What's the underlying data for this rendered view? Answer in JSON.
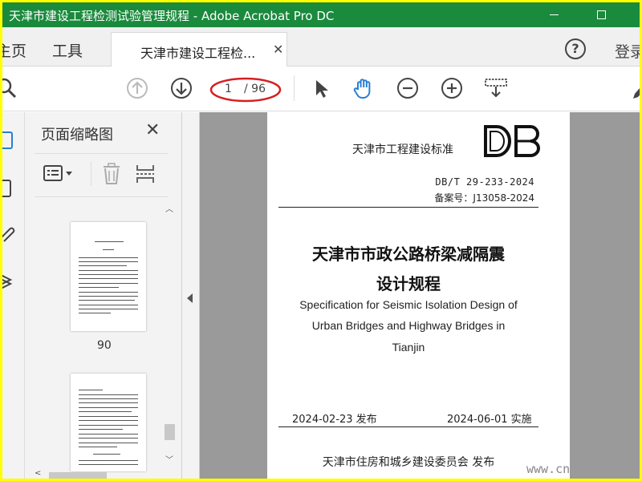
{
  "window": {
    "title": "天津市建设工程检测试验管理规程 - Adobe Acrobat Pro DC"
  },
  "tabs": {
    "home": "主页",
    "tools": "工具",
    "document": "天津市建设工程检...",
    "login": "登录"
  },
  "toolbar": {
    "current_page": "1",
    "total_pages": "/ 96"
  },
  "thumbnail_panel": {
    "title": "页面缩略图",
    "page_label": "90"
  },
  "document": {
    "standard": "天津市工程建设标准",
    "code": "DB/T 29-233-2024",
    "record": "备案号：J13058-2024",
    "title_line1": "天津市市政公路桥梁减隔震",
    "title_line2": "设计规程",
    "english_line1": "Specification for Seismic Isolation Design of",
    "english_line2": "Urban Bridges and Highway Bridges in",
    "english_line3": "Tianjin",
    "issue_date": "2024-02-23 发布",
    "effective_date": "2024-06-01 实施",
    "publisher": "天津市住房和城乡建设委员会  发布"
  },
  "watermark": "www.cn",
  "colors": {
    "titlebar": "#1a8a3c",
    "accent_blue": "#2a7fd4",
    "annotation_red": "#d62020",
    "frame": "#ffff00"
  }
}
